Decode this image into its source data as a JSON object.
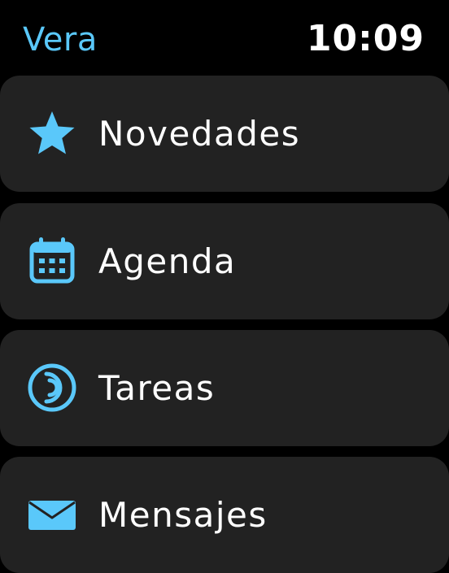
{
  "status_bar": {
    "app_name": "Vera",
    "time": "10:09"
  },
  "menu": {
    "items": [
      {
        "label": "Novedades",
        "icon": "star-icon"
      },
      {
        "label": "Agenda",
        "icon": "calendar-icon"
      },
      {
        "label": "Tareas",
        "icon": "activity-ring-icon"
      },
      {
        "label": "Mensajes",
        "icon": "envelope-icon"
      }
    ]
  },
  "colors": {
    "accent": "#5ac8fa",
    "background": "#000000",
    "cell_background": "#222222",
    "text": "#ffffff"
  }
}
